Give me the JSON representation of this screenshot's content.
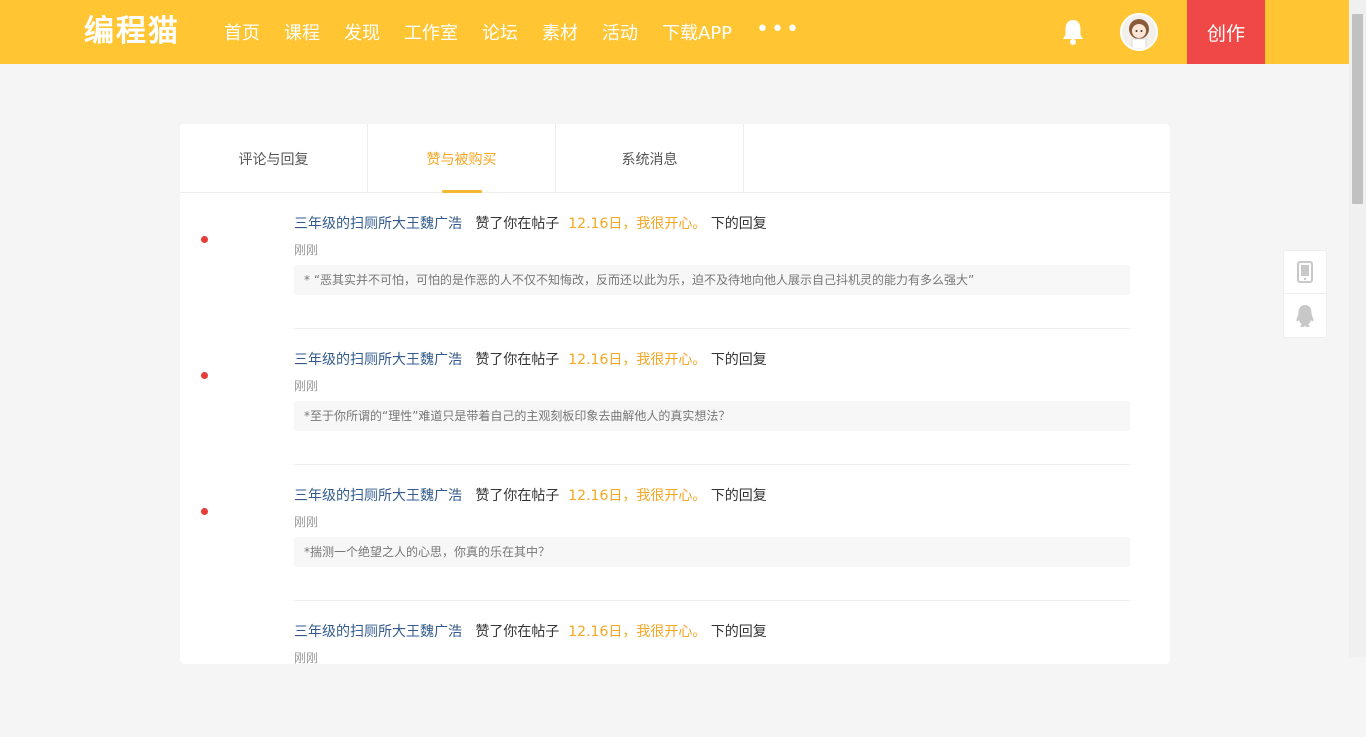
{
  "header": {
    "logo": "编程猫",
    "nav": [
      "首页",
      "课程",
      "发现",
      "工作室",
      "论坛",
      "素材",
      "活动",
      "下载APP"
    ],
    "more": "•••",
    "create_label": "创作",
    "icons": {
      "bell": "bell-icon",
      "avatar": "avatar"
    },
    "colors": {
      "header_bg": "#ffc533",
      "create_bg": "#f04747"
    }
  },
  "tabs": [
    {
      "label": "评论与回复",
      "active": false
    },
    {
      "label": "赞与被购买",
      "active": true
    },
    {
      "label": "系统消息",
      "active": false
    }
  ],
  "messages": [
    {
      "user": "三年级的扫厕所大王魏广浩",
      "action": "赞了你在帖子",
      "post": "12.16日，我很开心。",
      "suffix": "下的回复",
      "time": "刚刚",
      "quote": "* “恶其实并不可怕，可怕的是作恶的人不仅不知悔改，反而还以此为乐，迫不及待地向他人展示自己抖机灵的能力有多么强大”",
      "unread": true
    },
    {
      "user": "三年级的扫厕所大王魏广浩",
      "action": "赞了你在帖子",
      "post": "12.16日，我很开心。",
      "suffix": "下的回复",
      "time": "刚刚",
      "quote": "*至于你所谓的“理性”难道只是带着自己的主观刻板印象去曲解他人的真实想法？",
      "unread": true
    },
    {
      "user": "三年级的扫厕所大王魏广浩",
      "action": "赞了你在帖子",
      "post": "12.16日，我很开心。",
      "suffix": "下的回复",
      "time": "刚刚",
      "quote": "*揣测一个绝望之人的心思，你真的乐在其中？",
      "unread": true
    },
    {
      "user": "三年级的扫厕所大王魏广浩",
      "action": "赞了你在帖子",
      "post": "12.16日，我很开心。",
      "suffix": "下的回复",
      "time": "刚刚",
      "quote": "",
      "unread": false
    }
  ],
  "side_tools": [
    "mobile-icon",
    "qq-icon"
  ]
}
